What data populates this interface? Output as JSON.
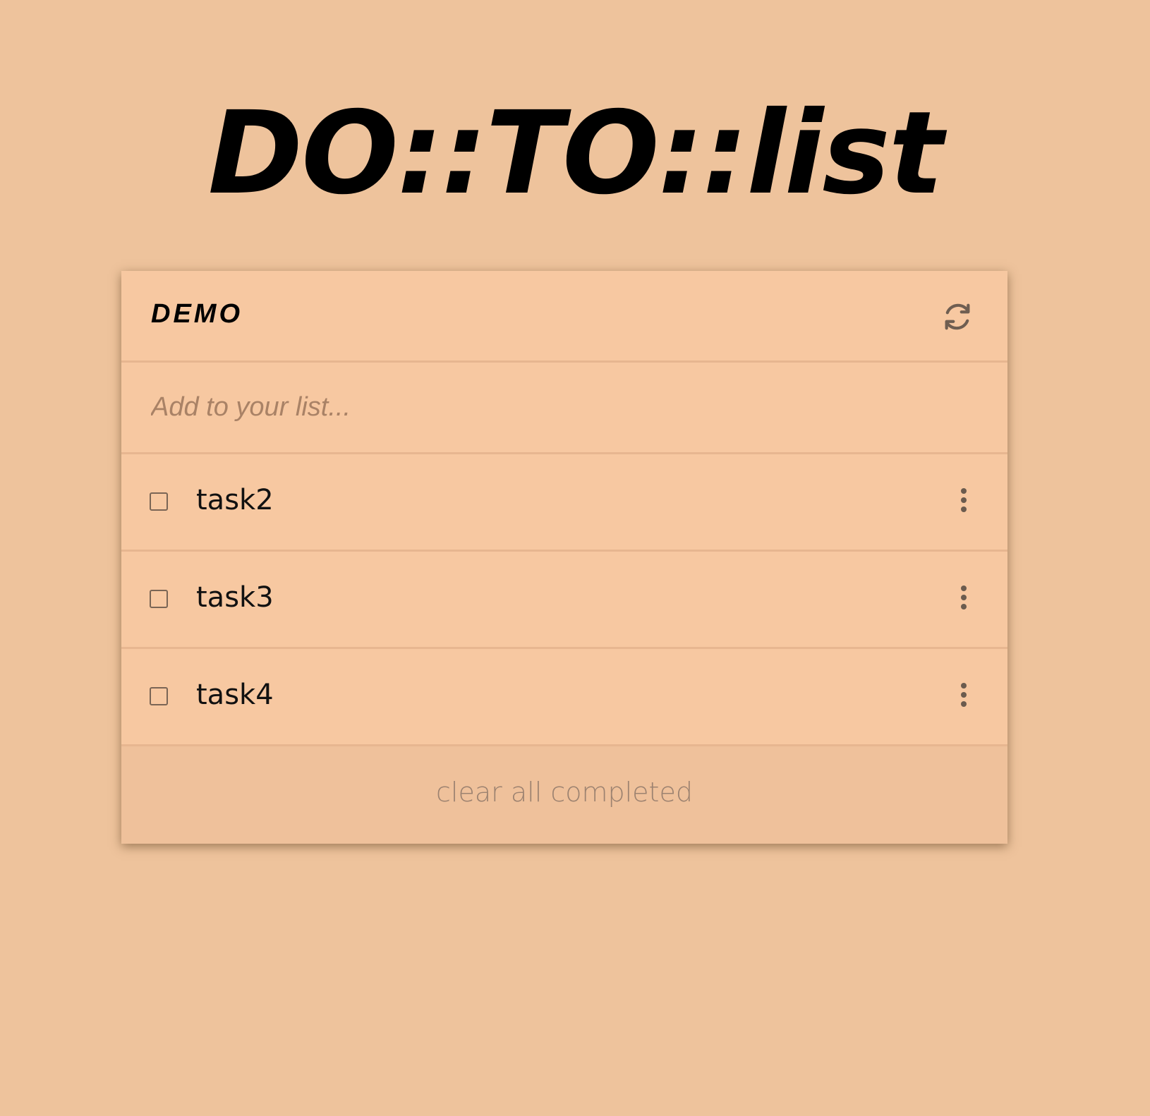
{
  "app": {
    "title": "DO::TO::list"
  },
  "list": {
    "name": "DEMO",
    "refresh_icon": "refresh-icon"
  },
  "add": {
    "placeholder": "Add to your list...",
    "value": ""
  },
  "tasks": [
    {
      "label": "task2",
      "completed": false
    },
    {
      "label": "task3",
      "completed": false
    },
    {
      "label": "task4",
      "completed": false
    }
  ],
  "footer": {
    "clear_label": "clear all completed"
  },
  "colors": {
    "background": "#eec39c",
    "card": "#f7c8a1",
    "divider": "#e7b690",
    "footer": "#efc19b"
  }
}
